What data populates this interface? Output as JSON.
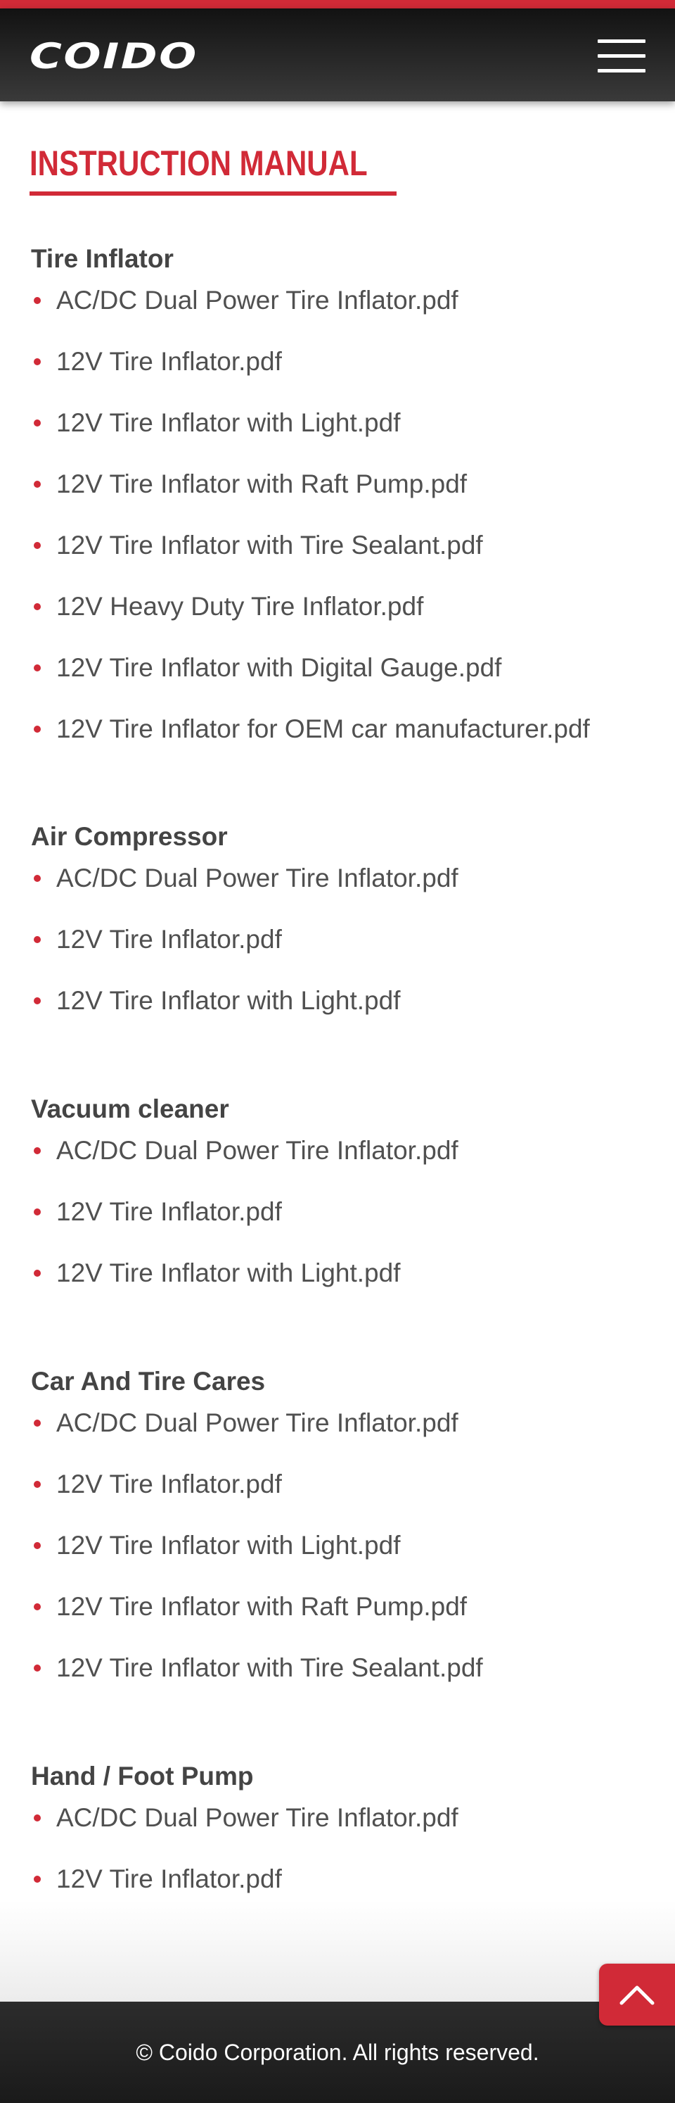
{
  "header": {
    "logo_text": "COIDO",
    "menu_icon": "hamburger-menu-icon"
  },
  "main": {
    "page_title": "INSTRUCTION MANUAL",
    "categories": [
      {
        "title": "Tire Inflator",
        "files": [
          "AC/DC Dual Power Tire Inflator.pdf",
          "12V Tire Inflator.pdf",
          "12V Tire Inflator with Light.pdf",
          "12V Tire Inflator with Raft Pump.pdf",
          "12V Tire Inflator with Tire Sealant.pdf",
          "12V Heavy Duty Tire Inflator.pdf",
          "12V Tire Inflator with Digital Gauge.pdf",
          "12V Tire Inflator for OEM car manufacturer.pdf"
        ]
      },
      {
        "title": "Air Compressor",
        "files": [
          "AC/DC Dual Power Tire Inflator.pdf",
          "12V Tire Inflator.pdf",
          "12V Tire Inflator with Light.pdf"
        ]
      },
      {
        "title": "Vacuum cleaner",
        "files": [
          "AC/DC Dual Power Tire Inflator.pdf",
          "12V Tire Inflator.pdf",
          "12V Tire Inflator with Light.pdf"
        ]
      },
      {
        "title": "Car And Tire Cares",
        "files": [
          "AC/DC Dual Power Tire Inflator.pdf",
          "12V Tire Inflator.pdf",
          "12V Tire Inflator with Light.pdf",
          "12V Tire Inflator with Raft Pump.pdf",
          "12V Tire Inflator with Tire Sealant.pdf"
        ]
      },
      {
        "title": "Hand / Foot Pump",
        "files": [
          "AC/DC Dual Power Tire Inflator.pdf",
          "12V Tire Inflator.pdf"
        ]
      }
    ]
  },
  "back_to_top": {
    "icon": "chevron-up-icon"
  },
  "footer": {
    "copyright": "© Coido Corporation. All rights reserved."
  },
  "colors": {
    "accent": "#d12a37",
    "header_bg": "#1e1e1e",
    "text": "#444444",
    "footer_bg": "#222222"
  }
}
